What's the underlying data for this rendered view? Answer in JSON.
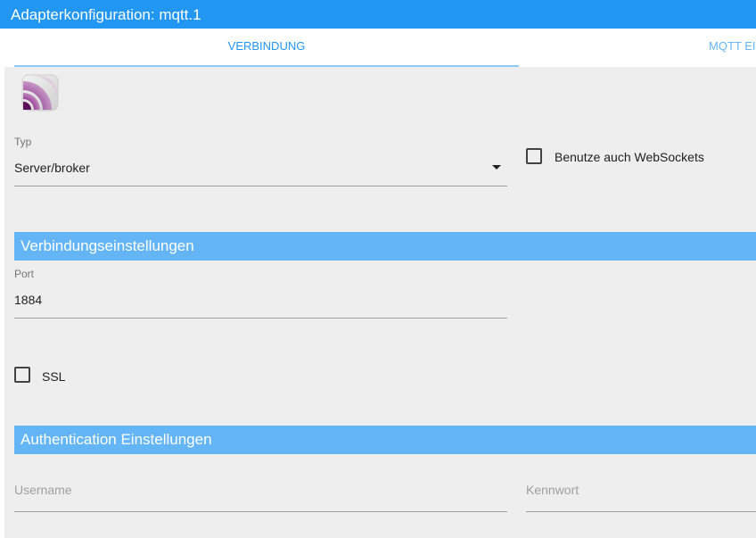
{
  "window": {
    "title": "Adapterkonfiguration: mqtt.1"
  },
  "tabs": [
    {
      "label": "VERBINDUNG",
      "active": true
    },
    {
      "label": "MQTT EI",
      "active": false
    }
  ],
  "adapter": {
    "logo_icon": "mqtt-logo-icon"
  },
  "type_field": {
    "label": "Typ",
    "value": "Server/broker"
  },
  "websockets": {
    "label": "Benutze auch WebSockets",
    "checked": false
  },
  "connection_section": {
    "title": "Verbindungseinstellungen"
  },
  "port_field": {
    "label": "Port",
    "value": "1884"
  },
  "ssl": {
    "label": "SSL",
    "checked": false
  },
  "auth_section": {
    "title": "Authentication Einstellungen"
  },
  "username_field": {
    "placeholder": "Username"
  },
  "password_field": {
    "placeholder": "Kennwort"
  },
  "colors": {
    "title_bar": "#2196f3",
    "section_header": "#64b5f6",
    "background": "#eeeeee"
  }
}
